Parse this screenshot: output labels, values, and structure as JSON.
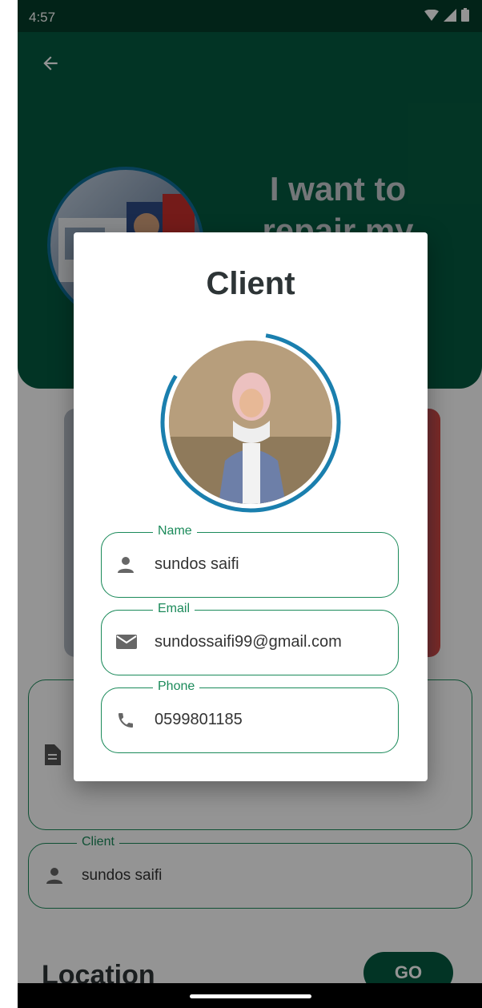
{
  "status_bar": {
    "time": "4:57"
  },
  "header": {
    "title": "I want to repair my"
  },
  "background": {
    "client_field": {
      "label": "Client",
      "value": "sundos saifi"
    },
    "location_title": "Location",
    "go_label": "GO"
  },
  "dialog": {
    "title": "Client",
    "fields": [
      {
        "label": "Name",
        "value": "sundos saifi",
        "icon": "person-icon"
      },
      {
        "label": "Email",
        "value": "sundossaifi99@gmail.com",
        "icon": "email-icon"
      },
      {
        "label": "Phone",
        "value": "0599801185",
        "icon": "phone-icon"
      }
    ]
  },
  "colors": {
    "primary": "#055b40",
    "status_bar": "#053d2a",
    "accent_outline": "#1b8a5a",
    "avatar_ring": "#1a7fae"
  }
}
